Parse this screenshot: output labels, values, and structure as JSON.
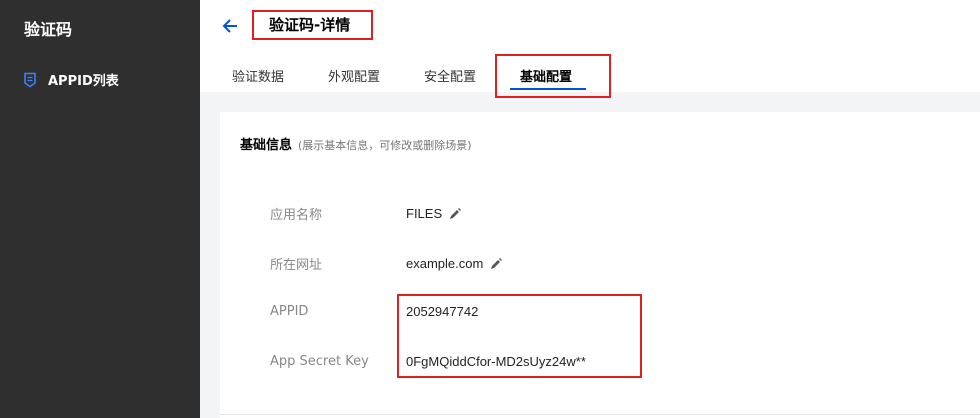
{
  "sidebar": {
    "title": "验证码",
    "items": [
      {
        "label": "APPID列表",
        "icon": "shield-list-icon"
      }
    ]
  },
  "header": {
    "title": "验证码-详情",
    "back_icon": "back-arrow-icon",
    "tabs": [
      {
        "label": "验证数据"
      },
      {
        "label": "外观配置"
      },
      {
        "label": "安全配置"
      },
      {
        "label": "基础配置",
        "active": true
      }
    ]
  },
  "card": {
    "title": "基础信息",
    "description": "(展示基本信息，可修改或删除场景)",
    "fields": [
      {
        "label": "应用名称",
        "value": "FILES",
        "editable": true
      },
      {
        "label": "所在网址",
        "value": "example.com",
        "editable": true
      },
      {
        "label": "APPID",
        "value": "2052947742",
        "editable": false
      },
      {
        "label": "App Secret Key",
        "value": "0FgMQiddCfor-MD2sUyz24w**",
        "editable": false
      }
    ]
  },
  "colors": {
    "sidebar_bg": "#2f2f2f",
    "accent": "#0052d9",
    "highlight": "#e02020"
  }
}
